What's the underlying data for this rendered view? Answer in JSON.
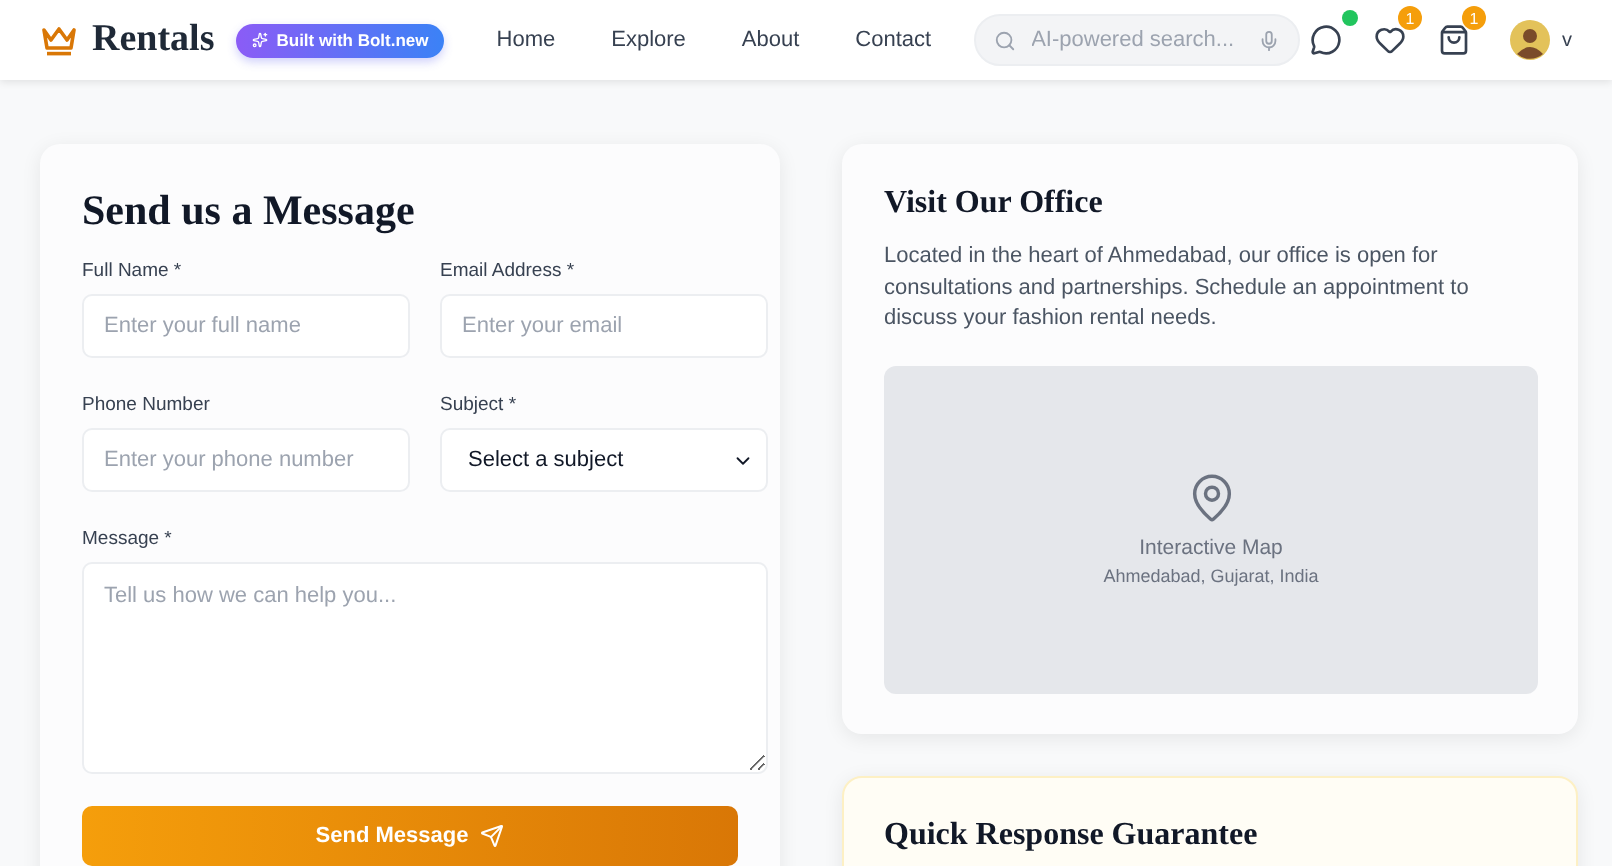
{
  "header": {
    "brand": "Rentals",
    "badge": "Built with Bolt.new",
    "nav": [
      {
        "label": "Home"
      },
      {
        "label": "Explore"
      },
      {
        "label": "About"
      },
      {
        "label": "Contact"
      }
    ],
    "search": {
      "placeholder": "AI-powered search..."
    },
    "chat": {
      "notification": true
    },
    "wishlist_count": "1",
    "cart_count": "1",
    "user_initial": "v"
  },
  "contact_form": {
    "title": "Send us a Message",
    "fields": [
      {
        "kind": "input",
        "label": "Full Name *",
        "placeholder": "Enter your full name"
      },
      {
        "kind": "input",
        "label": "Email Address *",
        "placeholder": "Enter your email"
      },
      {
        "kind": "input",
        "label": "Phone Number",
        "placeholder": "Enter your phone number"
      },
      {
        "kind": "select",
        "label": "Subject *",
        "value": "Select a subject"
      },
      {
        "kind": "textarea",
        "label": "Message *",
        "placeholder": "Tell us how we can help you..."
      }
    ],
    "submit": "Send Message"
  },
  "office": {
    "title": "Visit Our Office",
    "description": "Located in the heart of Ahmedabad, our office is open for consultations and partnerships. Schedule an appointment to discuss your fashion rental needs.",
    "map_title": "Interactive Map",
    "map_location": "Ahmedabad, Gujarat, India"
  },
  "guarantee": {
    "title": "Quick Response Guarantee"
  }
}
